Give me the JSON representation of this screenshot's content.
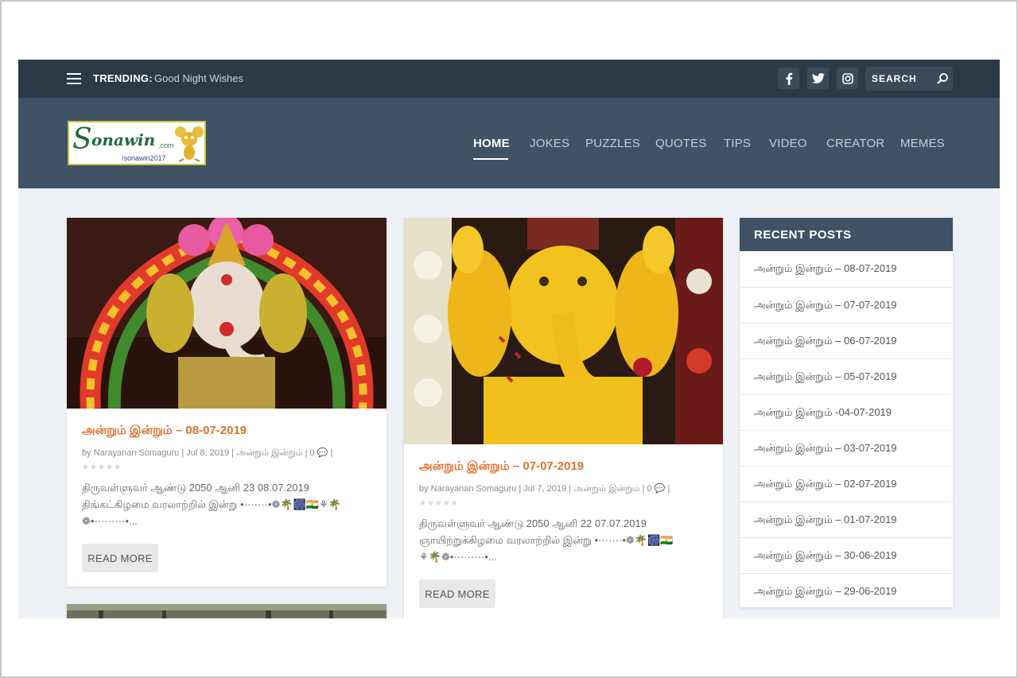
{
  "topbar": {
    "trending_label": "TRENDING:",
    "trending_text": "Good Night Wishes",
    "search_placeholder": "SEARCH",
    "social": [
      "f",
      "t",
      "ig"
    ]
  },
  "logo": {
    "s": "S",
    "brand": "onawin",
    "domain": ".com",
    "fb": "/sonawin2017"
  },
  "nav": [
    "HOME",
    "JOKES",
    "PUZZLES",
    "QUOTES",
    "TIPS",
    "VIDEO",
    "CREATOR",
    "MEMES"
  ],
  "posts": [
    {
      "title": "அன்றும் இன்றும் – 08-07-2019",
      "author": "by Narayanan Somaguru",
      "date": "Jul 8, 2019",
      "category": "அன்றும் இன்றும்",
      "comments": "0",
      "stars": "★★★★★",
      "excerpt_line1": "திருவள்ளுவர் ஆண்டு 2050 ஆனி 23 08.07.2019",
      "excerpt_line2": "திங்கட்கிழமை வரலாற்றில் இன்று •·······•❁🌴🎆🇮🇳⚘🌴",
      "excerpt_line3": "❁•·········•...",
      "button": "READ MORE"
    },
    {
      "title": "அன்றும் இன்றும் – 07-07-2019",
      "author": "by Narayanan Somaguru",
      "date": "Jul 7, 2019",
      "category": "அன்றும் இன்றும்",
      "comments": "0",
      "stars": "★★★★★",
      "excerpt_line1": "திருவள்ளுவர் ஆண்டு 2050 ஆனி 22 07.07.2019",
      "excerpt_line2": "ஞாயிற்றுக்கிழமை வரலாற்றில் இன்று •·······•❁🌴🎆🇮🇳",
      "excerpt_line3": "⚘🌴❁•·········•...",
      "button": "READ MORE"
    }
  ],
  "sidebar": {
    "title": "RECENT POSTS",
    "items": [
      "அன்றும் இன்றும் – 08-07-2019",
      "அன்றும் இன்றும் – 07-07-2019",
      "அன்றும் இன்றும் – 06-07-2019",
      "அன்றும் இன்றும் – 05-07-2019",
      "அன்றும் இன்றும் -04-07-2019",
      "அன்றும் இன்றும் – 03-07-2019",
      "அன்றும் இன்றும் – 02-07-2019",
      "அன்றும் இன்றும் – 01-07-2019",
      "அன்றும் இன்றும் – 30-06-2019",
      "அன்றும் இன்றும் – 29-06-2019"
    ]
  },
  "colors": {
    "topbar": "#2c3a48",
    "header": "#3f5266",
    "accent": "#e07030",
    "background": "#eef1f6"
  }
}
